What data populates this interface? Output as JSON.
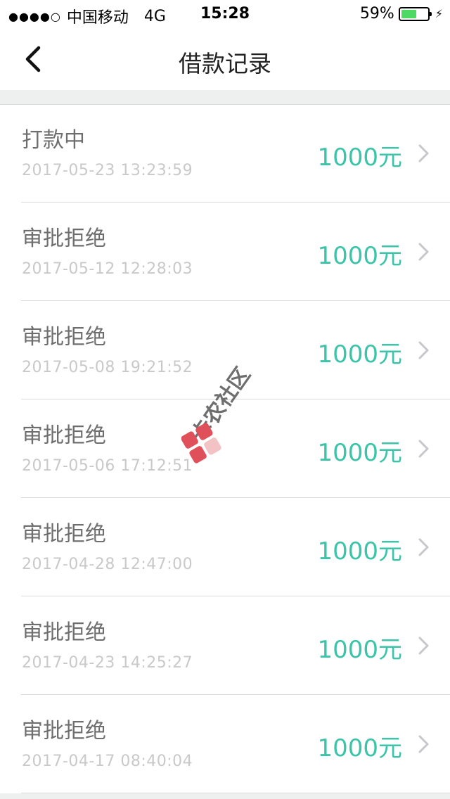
{
  "status_bar": {
    "signal": "●●●●○",
    "carrier": "中国移动",
    "network": "4G",
    "time": "15:28",
    "battery_percent": "59%",
    "battery_level": 0.59,
    "battery_color": "#4cd964"
  },
  "nav": {
    "title": "借款记录",
    "back_icon": "chevron-left-icon"
  },
  "records": [
    {
      "status": "打款中",
      "time": "2017-05-23 13:23:59",
      "amount": "1000元"
    },
    {
      "status": "审批拒绝",
      "time": "2017-05-12 12:28:03",
      "amount": "1000元"
    },
    {
      "status": "审批拒绝",
      "time": "2017-05-08 19:21:52",
      "amount": "1000元"
    },
    {
      "status": "审批拒绝",
      "time": "2017-05-06 17:12:51",
      "amount": "1000元"
    },
    {
      "status": "审批拒绝",
      "time": "2017-04-28 12:47:00",
      "amount": "1000元"
    },
    {
      "status": "审批拒绝",
      "time": "2017-04-23 14:25:27",
      "amount": "1000元"
    },
    {
      "status": "审批拒绝",
      "time": "2017-04-17 08:40:04",
      "amount": "1000元"
    }
  ],
  "watermark": {
    "text": "卡农社区",
    "logo_color": "#e0505a"
  },
  "colors": {
    "accent_amount": "#3cc4a8",
    "status_text": "#6e6e6e",
    "time_text": "#c9c9c9"
  }
}
